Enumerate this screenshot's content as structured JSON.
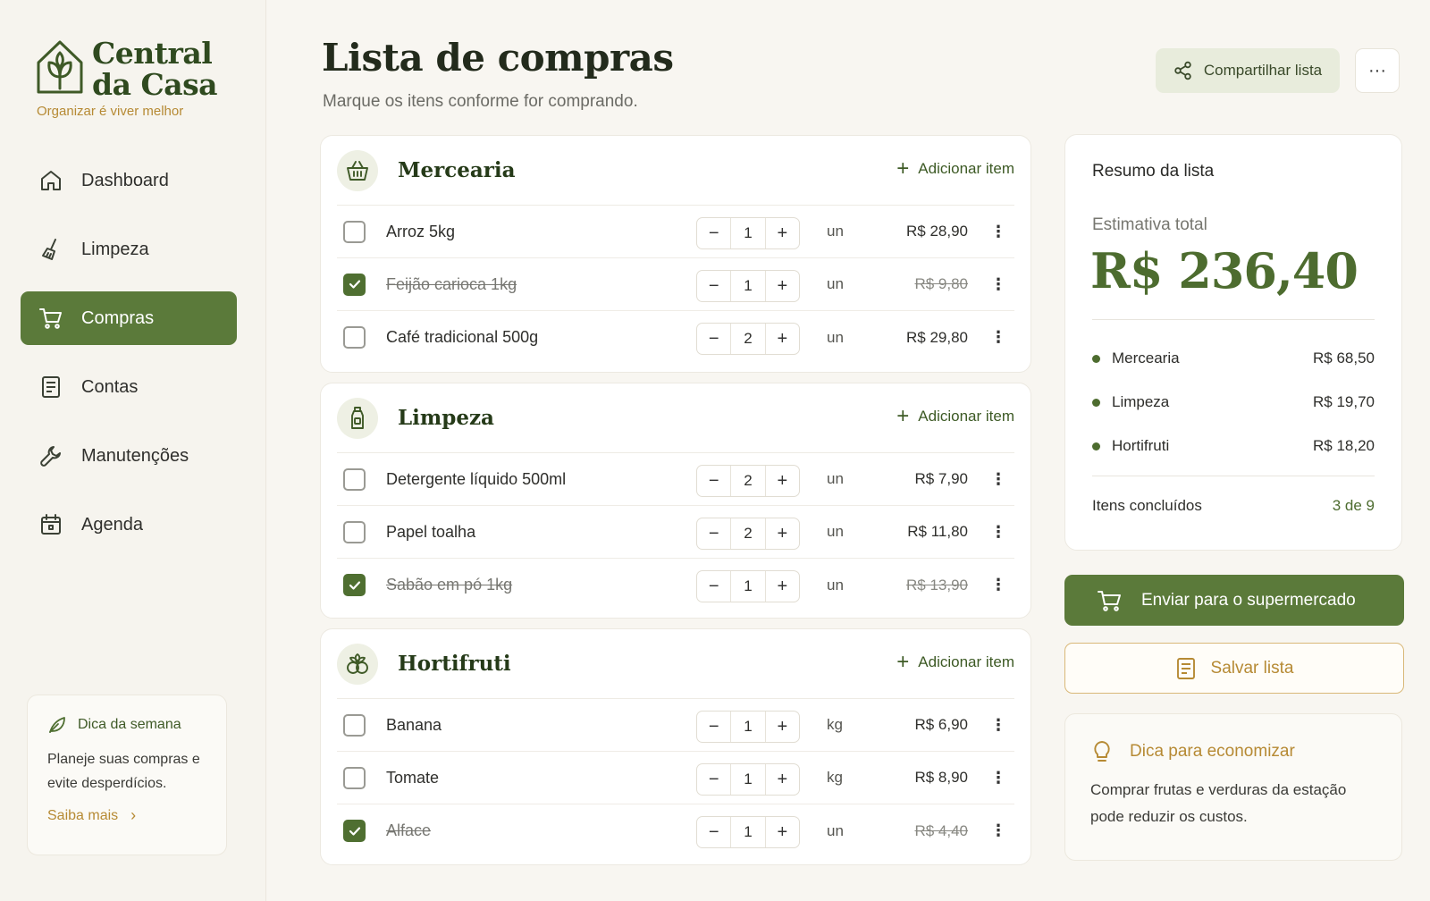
{
  "brand": {
    "title_line1": "Central",
    "title_line2": "da Casa",
    "tagline": "Organizar é viver melhor"
  },
  "nav": [
    {
      "label": "Dashboard",
      "icon": "home-icon",
      "active": false
    },
    {
      "label": "Limpeza",
      "icon": "broom-icon",
      "active": false
    },
    {
      "label": "Compras",
      "icon": "cart-icon",
      "active": true
    },
    {
      "label": "Contas",
      "icon": "document-icon",
      "active": false
    },
    {
      "label": "Manutenções",
      "icon": "wrench-icon",
      "active": false
    },
    {
      "label": "Agenda",
      "icon": "calendar-icon",
      "active": false
    }
  ],
  "tip_week": {
    "title": "Dica da semana",
    "text": "Planeje suas compras e evite desperdícios.",
    "link": "Saiba mais"
  },
  "header": {
    "title": "Lista de compras",
    "subtitle": "Marque os itens conforme for comprando.",
    "share_label": "Compartilhar lista",
    "more_label": "···"
  },
  "categories": [
    {
      "title": "Mercearia",
      "icon": "basket-icon",
      "add_label": "Adicionar item",
      "items": [
        {
          "name": "Arroz 5kg",
          "qty": "1",
          "unit": "un",
          "price": "R$ 28,90",
          "done": false
        },
        {
          "name": "Feijão carioca 1kg",
          "qty": "1",
          "unit": "un",
          "price": "R$ 9,80",
          "done": true
        },
        {
          "name": "Café tradicional 500g",
          "qty": "2",
          "unit": "un",
          "price": "R$ 29,80",
          "done": false
        }
      ]
    },
    {
      "title": "Limpeza",
      "icon": "bottle-icon",
      "add_label": "Adicionar item",
      "items": [
        {
          "name": "Detergente líquido 500ml",
          "qty": "2",
          "unit": "un",
          "price": "R$ 7,90",
          "done": false
        },
        {
          "name": "Papel toalha",
          "qty": "2",
          "unit": "un",
          "price": "R$ 11,80",
          "done": false
        },
        {
          "name": "Sabão em pó 1kg",
          "qty": "1",
          "unit": "un",
          "price": "R$ 13,90",
          "done": true
        }
      ]
    },
    {
      "title": "Hortifruti",
      "icon": "produce-icon",
      "add_label": "Adicionar item",
      "items": [
        {
          "name": "Banana",
          "qty": "1",
          "unit": "kg",
          "price": "R$ 6,90",
          "done": false
        },
        {
          "name": "Tomate",
          "qty": "1",
          "unit": "kg",
          "price": "R$ 8,90",
          "done": false
        },
        {
          "name": "Alface",
          "qty": "1",
          "unit": "un",
          "price": "R$ 4,40",
          "done": true
        }
      ]
    }
  ],
  "summary": {
    "title": "Resumo da lista",
    "estimate_label": "Estimativa total",
    "total": "R$ 236,40",
    "rows": [
      {
        "label": "Mercearia",
        "value": "R$ 68,50"
      },
      {
        "label": "Limpeza",
        "value": "R$ 19,70"
      },
      {
        "label": "Hortifruti",
        "value": "R$ 18,20"
      }
    ],
    "done_label": "Itens concluídos",
    "done_value": "3 de 9"
  },
  "actions": {
    "send_label": "Enviar para o supermercado",
    "save_label": "Salvar lista"
  },
  "econ_tip": {
    "title": "Dica para economizar",
    "text": "Comprar frutas e verduras da estação pode reduzir os custos."
  },
  "colors": {
    "primary": "#5b7a3a",
    "accent": "#b68a34",
    "background": "#f8f6f1"
  }
}
